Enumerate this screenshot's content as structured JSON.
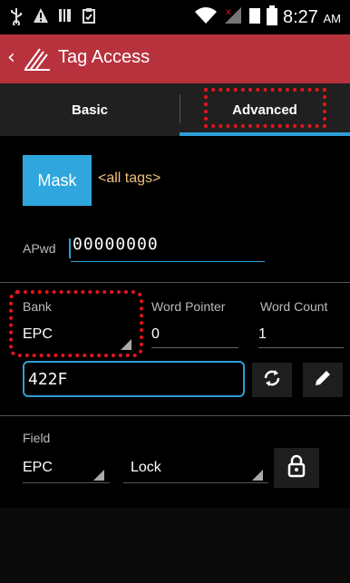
{
  "status_bar": {
    "time": "8:27",
    "ampm": "AM"
  },
  "app_bar": {
    "title": "Tag Access"
  },
  "tabs": [
    {
      "label": "Basic",
      "selected": false
    },
    {
      "label": "Advanced",
      "selected": true
    }
  ],
  "mask": {
    "button_label": "Mask",
    "text": "<all tags>"
  },
  "apwd": {
    "label": "APwd",
    "value": "00000000"
  },
  "bank": {
    "label": "Bank",
    "value": "EPC"
  },
  "word_pointer": {
    "label": "Word Pointer",
    "value": "0"
  },
  "word_count": {
    "label": "Word Count",
    "value": "1"
  },
  "data_field": {
    "value": "422F"
  },
  "field": {
    "label": "Field",
    "value": "EPC",
    "lock_value": "Lock"
  },
  "colors": {
    "app_bar": "#b8323d",
    "accent": "#2e9fd6",
    "highlight": "#e8141c"
  },
  "icons": {
    "refresh": "refresh-icon",
    "edit": "pencil-icon",
    "lock": "lock-icon"
  }
}
